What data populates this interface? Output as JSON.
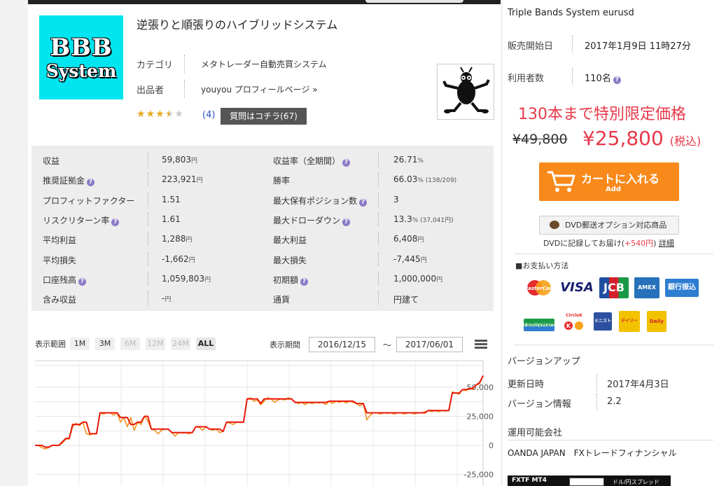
{
  "product": {
    "logo_line1": "BBB",
    "logo_line2": "System",
    "title": "逆張りと順張りのハイブリッドシステム",
    "category_label": "カテゴリ",
    "category_value": "メタトレーダー自動売買システム",
    "seller_label": "出品者",
    "seller_value": "youyou プロフィールページ »",
    "rating_stars": 3.5,
    "review_count": "(4)",
    "question_button": "質問はコチラ(67)"
  },
  "stats": {
    "rows": [
      {
        "k1": "収益",
        "h1": false,
        "v1": "59,803",
        "u1": "円",
        "k2": "収益率（全期間）",
        "h2": true,
        "v2": "26.71",
        "u2": "%"
      },
      {
        "k1": "推奨証拠金",
        "h1": true,
        "v1": "223,921",
        "u1": "円",
        "k2": "勝率",
        "h2": false,
        "v2": "66.03",
        "u2": "% (138/209)"
      },
      {
        "k1": "プロフィットファクター",
        "h1": false,
        "v1": "1.51",
        "u1": "",
        "k2": "最大保有ポジション数",
        "h2": true,
        "v2": "3",
        "u2": ""
      },
      {
        "k1": "リスクリターン率",
        "h1": true,
        "v1": "1.61",
        "u1": "",
        "k2": "最大ドローダウン",
        "h2": true,
        "v2": "13.3",
        "u2": "% (37,041円)"
      },
      {
        "k1": "平均利益",
        "h1": false,
        "v1": "1,288",
        "u1": "円",
        "k2": "最大利益",
        "h2": false,
        "v2": "6,408",
        "u2": "円"
      },
      {
        "k1": "平均損失",
        "h1": false,
        "v1": "-1,662",
        "u1": "円",
        "k2": "最大損失",
        "h2": false,
        "v2": "-7,445",
        "u2": "円"
      },
      {
        "k1": "口座残高",
        "h1": true,
        "v1": "1,059,803",
        "u1": "円",
        "k2": "初期額",
        "h2": true,
        "v2": "1,000,000",
        "u2": "円"
      },
      {
        "k1": "含み収益",
        "h1": false,
        "v1": "-",
        "u1": "円",
        "k2": "通貨",
        "h2": false,
        "v2": "円建て",
        "u2": ""
      }
    ]
  },
  "chart_controls": {
    "range_label": "表示範囲",
    "ranges": [
      {
        "label": "1M",
        "state": "normal"
      },
      {
        "label": "3M",
        "state": "normal"
      },
      {
        "label": "6M",
        "state": "disabled"
      },
      {
        "label": "12M",
        "state": "disabled"
      },
      {
        "label": "24M",
        "state": "disabled"
      },
      {
        "label": "ALL",
        "state": "active"
      }
    ],
    "period_label": "表示期間",
    "date_from": "2016/12/15",
    "tilde": "～",
    "date_to": "2017/06/01"
  },
  "chart_data": {
    "type": "line",
    "colors": {
      "series1": "#e8190c",
      "series2": "#f3941f"
    },
    "y_ticks": [
      "50,000",
      "25,000",
      "0",
      "-25,000"
    ],
    "ylim": [
      -25000,
      50000
    ],
    "series": [
      {
        "values": [
          0,
          0,
          0,
          -1500,
          -1500,
          0,
          0,
          0,
          3000,
          6000,
          6000,
          18000,
          18000,
          18000,
          20000,
          20000,
          10000,
          10000,
          10000,
          28000,
          28000,
          28000,
          28000,
          28000,
          28000,
          24000,
          24000,
          24000,
          18000,
          18000,
          20000,
          20000,
          25000,
          25000,
          14000,
          14000,
          14000,
          14000,
          14000,
          14000,
          11000,
          11000,
          11000,
          11000,
          11000,
          11000,
          11000,
          16000,
          16000,
          16000,
          16000,
          14000,
          14000,
          14000,
          14000,
          12000,
          20000,
          20000,
          20000,
          20000,
          20000,
          20000,
          40000,
          40000,
          40000,
          40000,
          36000,
          40000,
          40000,
          40000,
          40000,
          40000,
          40000,
          40000,
          40000,
          40000,
          37000,
          37000,
          37000,
          37000,
          37000,
          37000,
          37000,
          37000,
          37000,
          37000,
          38000,
          38000,
          38000,
          38000,
          38000,
          38000,
          38000,
          38000,
          36000,
          36000,
          36000,
          28000,
          28000,
          28000,
          28000,
          28000,
          28000,
          28000,
          28000,
          28000,
          28000,
          28000,
          28000,
          28000,
          28000,
          28000,
          28000,
          28000,
          28000,
          30000,
          30000,
          30000,
          30000,
          30000,
          30000,
          30000,
          45000,
          45000,
          45000,
          48000,
          48000,
          49000,
          49000,
          52000,
          54000,
          60000
        ]
      },
      {
        "values": [
          0,
          0,
          -2000,
          -3000,
          -2000,
          0,
          0,
          0,
          2000,
          5500,
          5500,
          16000,
          19000,
          17000,
          20000,
          10000,
          9000,
          10000,
          10500,
          28000,
          27000,
          28000,
          28000,
          26000,
          28000,
          20000,
          24000,
          16000,
          24000,
          13000,
          20000,
          18000,
          25000,
          21000,
          14000,
          13000,
          10000,
          13000,
          14000,
          14000,
          11000,
          8000,
          11000,
          10500,
          11000,
          10000,
          11000,
          16000,
          15500,
          13000,
          16000,
          14000,
          13000,
          14000,
          11000,
          12000,
          20000,
          19000,
          18000,
          20000,
          19500,
          20000,
          40000,
          41000,
          38000,
          39000,
          35000,
          38000,
          41000,
          40000,
          37000,
          39000,
          40000,
          39000,
          41000,
          40000,
          37000,
          36000,
          37000,
          35000,
          37000,
          36000,
          37000,
          36500,
          37000,
          35000,
          38000,
          36000,
          38000,
          37000,
          38000,
          36500,
          38000,
          37000,
          36000,
          34000,
          36000,
          22000,
          26000,
          28000,
          28000,
          27000,
          28000,
          27500,
          28000,
          27000,
          28000,
          28000,
          27000,
          28000,
          28000,
          27000,
          28000,
          28000,
          29000,
          30000,
          29000,
          30000,
          29000,
          30000,
          29500,
          30000,
          46000,
          45000,
          44000,
          48000,
          47000,
          49000,
          48000,
          52000,
          53000,
          60000
        ]
      }
    ]
  },
  "sidebar": {
    "product_name": "Triple Bands System eurusd",
    "sale_start_label": "販売開始日",
    "sale_start_value": "2017年1月9日 11時27分",
    "users_label": "利用者数",
    "users_value": "110名",
    "limited_text": "130本まで特別限定価格",
    "old_price": "¥49,800",
    "new_price": "¥25,800",
    "tax_label": "(税込)",
    "cart_label": "カートに入れる",
    "cart_sub": "Add",
    "dvd_button": "DVD郵送オプション対応商品",
    "dvd_note_pre": "DVDに記録してお届け(",
    "dvd_note_price": "+540円",
    "dvd_note_post": ")",
    "dvd_note_link": "詳細",
    "payment_heading": "■お支払い方法",
    "payments": [
      "MasterCard",
      "VISA",
      "JCB",
      "AMEX",
      "銀行振込",
      "FamilyMart",
      "CircleK",
      "ミニストップ",
      "デイリー",
      "Daily"
    ],
    "versionup_heading": "バージョンアップ",
    "updated_label": "更新日時",
    "updated_value": "2017年4月3日",
    "version_label": "バージョン情報",
    "version_value": "2.2",
    "brokers_heading": "運用可能会社",
    "brokers_value": "OANDA JAPAN　FXトレードフィナンシャル",
    "banner_left": "FXTF MT4",
    "banner_right": "ドル/円スプレッド"
  }
}
